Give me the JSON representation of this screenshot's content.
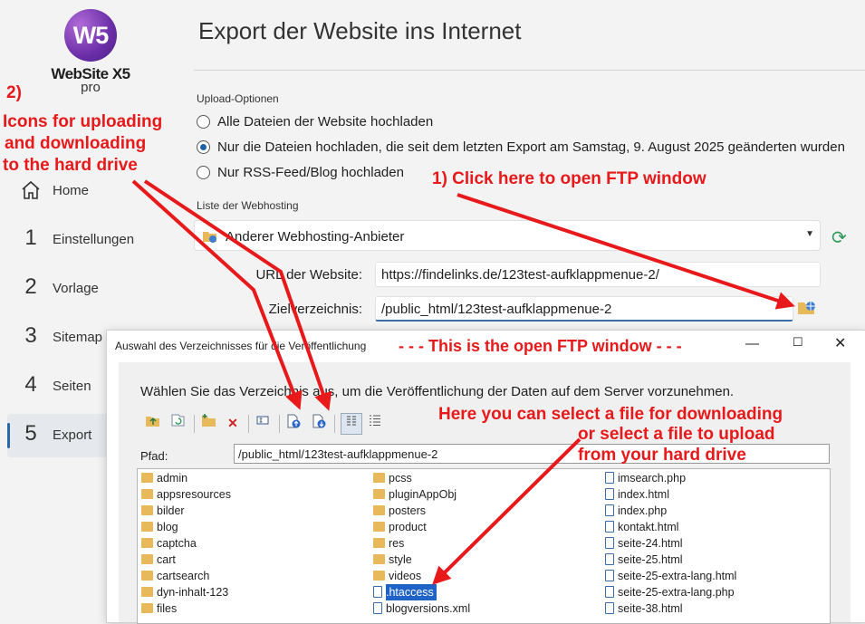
{
  "app": {
    "logo_text": "W5",
    "name": "WebSite X5",
    "edition": "pro"
  },
  "sidebar": {
    "items": [
      {
        "num": "",
        "label": "Home",
        "icon": "home-icon"
      },
      {
        "num": "1",
        "label": "Einstellungen"
      },
      {
        "num": "2",
        "label": "Vorlage"
      },
      {
        "num": "3",
        "label": "Sitemap"
      },
      {
        "num": "4",
        "label": "Seiten"
      },
      {
        "num": "5",
        "label": "Export",
        "active": true
      }
    ]
  },
  "page": {
    "title": "Export der Website ins Internet"
  },
  "upload": {
    "section": "Upload-Optionen",
    "options": [
      {
        "label": "Alle Dateien der Website hochladen",
        "checked": false
      },
      {
        "label": "Nur die Dateien hochladen, die seit dem letzten Export am Samstag, 9. August 2025 geänderten wurden",
        "checked": true
      },
      {
        "label": "Nur RSS-Feed/Blog hochladen",
        "checked": false
      }
    ]
  },
  "hosting": {
    "section": "Liste der Webhosting",
    "selected": "Anderer Webhosting-Anbieter",
    "url_label": "URL der Website:",
    "url_value": "https://findelinks.de/123test-aufklappmenue-2/",
    "dir_label": "Zielverzeichnis:",
    "dir_value": "/public_html/123test-aufklappmenue-2"
  },
  "dialog": {
    "title": "Auswahl des Verzeichnisses für die Veröffentlichung",
    "description": "Wählen Sie das Verzeichnis aus, um die Veröffentlichung der Daten auf dem Server vorzunehmen.",
    "path_label": "Pfad:",
    "path_value": "/public_html/123test-aufklappmenue-2",
    "columns": [
      [
        "admin",
        "appsresources",
        "bilder",
        "blog",
        "captcha",
        "cart",
        "cartsearch",
        "dyn-inhalt-123",
        "files"
      ],
      [
        "pcss",
        "pluginAppObj",
        "posters",
        "product",
        "res",
        "style",
        "videos",
        ".htaccess",
        "blogversions.xml"
      ],
      [
        "imsearch.php",
        "index.html",
        "index.php",
        "kontakt.html",
        "seite-24.html",
        "seite-25.html",
        "seite-25-extra-lang.html",
        "seite-25-extra-lang.php",
        "seite-38.html"
      ]
    ],
    "selected_file": ".htaccess"
  },
  "annotations": {
    "a1": "1) Click here to open FTP window",
    "a2_num": "2)",
    "a2_lines": [
      "Icons for uploading",
      "and downloading",
      "to the hard drive"
    ],
    "ftp_window": "- - - This is the open FTP window - - -",
    "select_lines": [
      "Here you can select a file for downloading",
      "or select a file to upload",
      "from your hard drive"
    ]
  },
  "colors": {
    "annotation": "#e8191a",
    "accent": "#1f63c6",
    "refresh": "#2e9a5a"
  }
}
